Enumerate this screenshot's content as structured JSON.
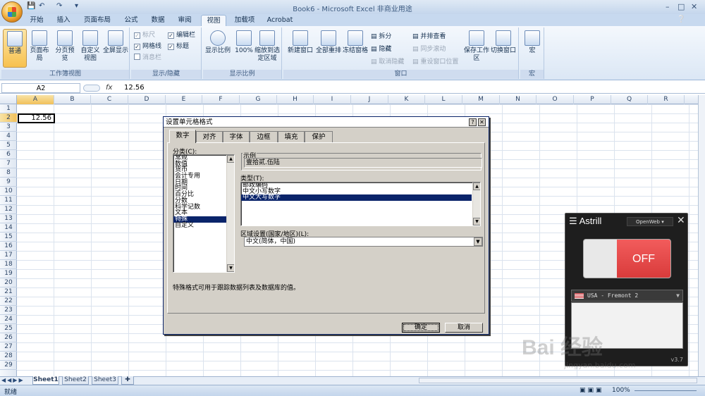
{
  "window": {
    "title": "Book6 - Microsoft Excel 非商业用途"
  },
  "ribbon": {
    "tabs": [
      "开始",
      "插入",
      "页面布局",
      "公式",
      "数据",
      "审阅",
      "视图",
      "加载项",
      "Acrobat"
    ],
    "active_tab": "视图",
    "groups": {
      "workbook_views": {
        "caption": "工作簿视图",
        "buttons": [
          "普通",
          "页面布局",
          "分页预览",
          "自定义视图",
          "全屏显示"
        ]
      },
      "show_hide": {
        "caption": "显示/隐藏",
        "items": [
          "标尺",
          "编辑栏",
          "网格线",
          "标题",
          "消息栏"
        ]
      },
      "zoom": {
        "caption": "显示比例",
        "buttons": [
          "显示比例",
          "100%",
          "缩放到选定区域"
        ]
      },
      "window": {
        "caption": "窗口",
        "buttons": [
          "新建窗口",
          "全部重排",
          "冻结窗格",
          "保存工作区",
          "切换窗口"
        ],
        "small": [
          "拆分",
          "隐藏",
          "取消隐藏",
          "并排查看",
          "同步滚动",
          "重设窗口位置"
        ]
      },
      "macros": {
        "caption": "宏",
        "buttons": [
          "宏"
        ]
      }
    }
  },
  "formula_bar": {
    "name_box": "A2",
    "fx": "fx",
    "formula": "12.56"
  },
  "columns": [
    "A",
    "B",
    "C",
    "D",
    "E",
    "F",
    "G",
    "H",
    "I",
    "J",
    "K",
    "L",
    "M",
    "N",
    "O",
    "P",
    "Q",
    "R"
  ],
  "rows": [
    "1",
    "2",
    "3",
    "4",
    "5",
    "6",
    "7",
    "8",
    "9",
    "10",
    "11",
    "12",
    "13",
    "14",
    "15",
    "16",
    "17",
    "18",
    "19",
    "20",
    "21",
    "22",
    "23",
    "24",
    "25",
    "26",
    "27",
    "28",
    "29"
  ],
  "cell_a2": "12.56",
  "sheets": [
    "Sheet1",
    "Sheet2",
    "Sheet3"
  ],
  "status": {
    "ready": "就绪",
    "zoom": "100%"
  },
  "dialog": {
    "title": "设置单元格格式",
    "tabs": [
      "数字",
      "对齐",
      "字体",
      "边框",
      "填充",
      "保护"
    ],
    "active_tab": "数字",
    "category_label": "分类(C):",
    "categories": [
      "常规",
      "数值",
      "货币",
      "会计专用",
      "日期",
      "时间",
      "百分比",
      "分数",
      "科学记数",
      "文本",
      "特殊",
      "自定义"
    ],
    "selected_category": "特殊",
    "sample_label": "示例",
    "sample_value": "壹拾贰.伍陆",
    "type_label": "类型(T):",
    "types": [
      "邮政编码",
      "中文小写数字",
      "中文大写数字"
    ],
    "selected_type": "中文大写数字",
    "locale_label": "区域设置(国家/地区)(L):",
    "locale_value": "中文(简体，中国)",
    "description": "特殊格式可用于跟踪数据列表及数据库的值。",
    "ok": "确定",
    "cancel": "取消"
  },
  "astrill": {
    "title": "Astrill",
    "mode": "OpenWeb",
    "toggle": "OFF",
    "server": "USA - Fremont 2",
    "version": "v3.7"
  },
  "watermark": {
    "text": "Bai 经验",
    "url": "jingyan.baidu.com"
  }
}
